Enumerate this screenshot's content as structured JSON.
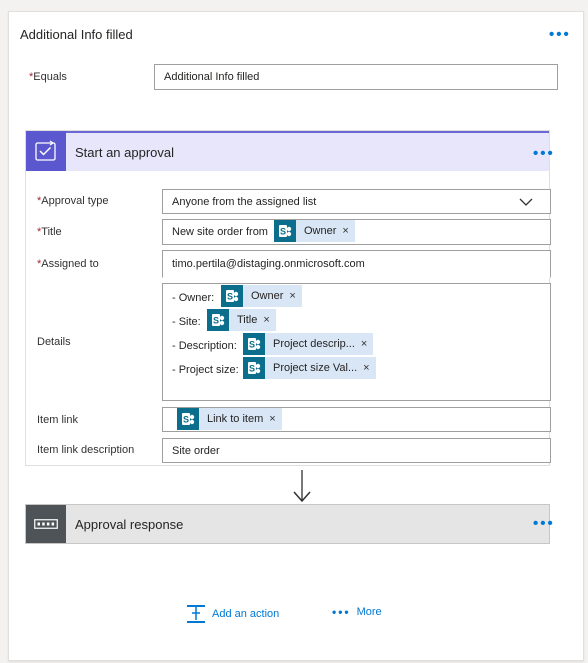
{
  "condition": {
    "title": "Additional Info filled",
    "equals_label": "Equals",
    "equals_value": "Additional Info filled"
  },
  "approval": {
    "title": "Start an approval",
    "approval_type_label": "Approval type",
    "approval_type_value": "Anyone from the assigned list",
    "title_label": "Title",
    "title_prefix": "New site order from",
    "title_token": "Owner",
    "assigned_label": "Assigned to",
    "assigned_value": "timo.pertila@distaging.onmicrosoft.com",
    "details_label": "Details",
    "details_lines": [
      {
        "prefix": "- Owner:",
        "token": "Owner"
      },
      {
        "prefix": "- Site:",
        "token": "Title"
      },
      {
        "prefix": "- Description:",
        "token": "Project descrip..."
      },
      {
        "prefix": "- Project size:",
        "token": "Project size Val..."
      }
    ],
    "item_link_label": "Item link",
    "item_link_token": "Link to item",
    "item_link_desc_label": "Item link description",
    "item_link_desc_value": "Site order"
  },
  "response": {
    "title": "Approval response"
  },
  "footer": {
    "add_action": "Add an action",
    "more": "More"
  },
  "required_mark": "*",
  "remove_mark": "×",
  "more_glyph": "•••",
  "colors": {
    "accent": "#0078d4",
    "approval_icon": "#5b57cf",
    "approval_header": "#e8e6fb",
    "sharepoint": "#0b6e8c",
    "token_bg": "#d9e6f5",
    "required": "#a4262c"
  }
}
